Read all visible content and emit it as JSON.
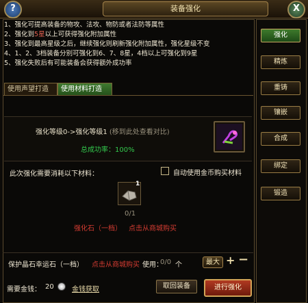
{
  "window": {
    "title": "装备强化",
    "help_glyph": "?",
    "close_glyph": "X"
  },
  "intro": {
    "line1": "1、强化可提高装备的物攻、法攻、物防或者法防等属性",
    "line2a": "2、强化到",
    "line2b": "5星",
    "line2c": "以上可获得强化附加属性",
    "line3": "3、强化到最高星级之后，继续强化则刷新强化附加属性，强化星级不变",
    "line4": "4、1、2、3档装备分别可强化到6、7、8星，4档以上可强化到9星",
    "line5": "5、强化失败后有可能装备会获得额外成功率"
  },
  "tabs": {
    "prestige": "使用声望打造",
    "material": "使用材料打造"
  },
  "strength": {
    "level_text": "强化等级0->强化等级1",
    "compare_hint": "(移到此处查看对比)",
    "success_rate": "总成功率：100%"
  },
  "materials": {
    "label": "此次强化需要消耗以下材料：",
    "auto_buy_label": "自动使用金币购买材料",
    "item_count": "1",
    "qty": "0/1",
    "name": "强化石（一档）",
    "buy": "点击从商城购买"
  },
  "protect": {
    "label": "保护晶石幸运石（一档）",
    "buy": "点击从商城购买",
    "use_label": "使用：",
    "use_count": "0/0",
    "use_unit": "个",
    "max_label": "最大",
    "plus": "+",
    "minus": "−"
  },
  "footer": {
    "gold_label": "需要金钱：",
    "gold_value": "20",
    "gold_link": "金钱获取",
    "recall_button": "取回装备",
    "proceed_button": "进行强化"
  },
  "sidebar": {
    "items": [
      {
        "label": "强化",
        "active": true
      },
      {
        "label": "精炼",
        "active": false
      },
      {
        "label": "重铸",
        "active": false
      },
      {
        "label": "镶嵌",
        "active": false
      },
      {
        "label": "合成",
        "active": false
      },
      {
        "label": "绑定",
        "active": false
      },
      {
        "label": "锻造",
        "active": false
      }
    ]
  }
}
